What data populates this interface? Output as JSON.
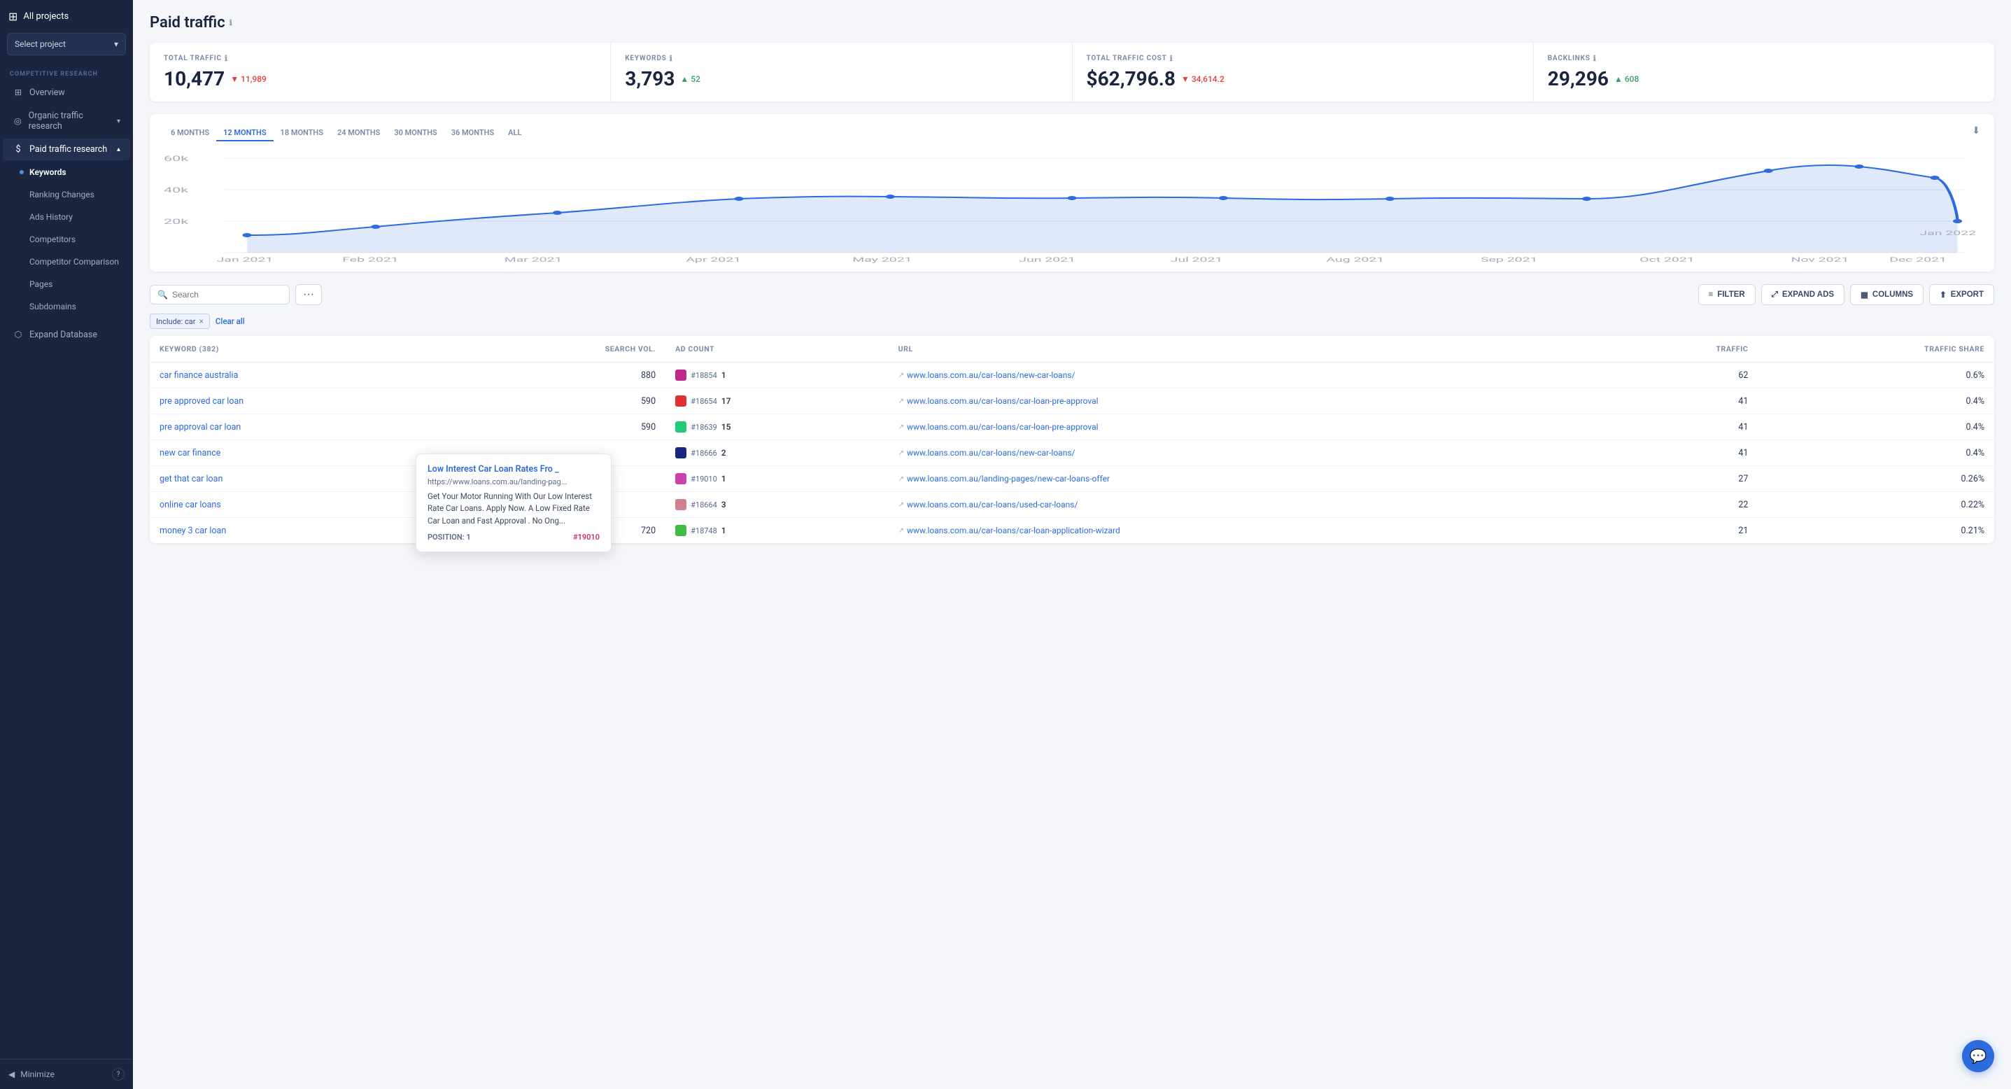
{
  "sidebar": {
    "allProjects": "All projects",
    "selectProject": "Select project",
    "sectionLabel": "COMPETITIVE RESEARCH",
    "items": [
      {
        "id": "overview",
        "label": "Overview",
        "icon": "grid",
        "type": "top"
      },
      {
        "id": "organic-traffic",
        "label": "Organic traffic research",
        "icon": "eye",
        "type": "top",
        "expandable": true
      },
      {
        "id": "paid-traffic",
        "label": "Paid traffic research",
        "icon": "dollar",
        "type": "top",
        "expandable": true,
        "active": true
      },
      {
        "id": "keywords",
        "label": "Keywords",
        "type": "sub",
        "active": true
      },
      {
        "id": "ranking-changes",
        "label": "Ranking Changes",
        "type": "sub"
      },
      {
        "id": "ads-history",
        "label": "Ads History",
        "type": "sub"
      },
      {
        "id": "competitors",
        "label": "Competitors",
        "type": "sub"
      },
      {
        "id": "competitor-comparison",
        "label": "Competitor Comparison",
        "type": "sub"
      },
      {
        "id": "pages",
        "label": "Pages",
        "type": "sub"
      },
      {
        "id": "subdomains",
        "label": "Subdomains",
        "type": "sub"
      },
      {
        "id": "expand-database",
        "label": "Expand Database",
        "icon": "database",
        "type": "top"
      }
    ],
    "minimize": "Minimize"
  },
  "pageTitle": "Paid traffic",
  "stats": [
    {
      "label": "TOTAL TRAFFIC",
      "value": "10,477",
      "delta": "▼ 11,989",
      "deltaType": "down"
    },
    {
      "label": "KEYWORDS",
      "value": "3,793",
      "delta": "▲ 52",
      "deltaType": "up"
    },
    {
      "label": "TOTAL TRAFFIC COST",
      "value": "$62,796.8",
      "delta": "▼ 34,614.2",
      "deltaType": "down"
    },
    {
      "label": "BACKLINKS",
      "value": "29,296",
      "delta": "▲ 608",
      "deltaType": "up"
    }
  ],
  "timeTabs": [
    "6 MONTHS",
    "12 MONTHS",
    "18 MONTHS",
    "24 MONTHS",
    "30 MONTHS",
    "36 MONTHS",
    "ALL"
  ],
  "activeTimeTab": "12 MONTHS",
  "chart": {
    "yLabels": [
      "60k",
      "40k",
      "20k"
    ],
    "xLabels": [
      "Jan 2021",
      "Feb 2021",
      "Mar 2021",
      "Apr 2021",
      "May 2021",
      "Jun 2021",
      "Jul 2021",
      "Aug 2021",
      "Sep 2021",
      "Oct 2021",
      "Nov 2021",
      "Dec 2021",
      "Jan 2022"
    ]
  },
  "toolbar": {
    "searchPlaceholder": "Search",
    "filterLabel": "FILTER",
    "expandAdsLabel": "EXPAND ADS",
    "columnsLabel": "COLUMNS",
    "exportLabel": "EXPORT"
  },
  "filterTags": [
    {
      "text": "Include: car",
      "removable": true
    }
  ],
  "clearAll": "Clear all",
  "table": {
    "columns": [
      {
        "id": "keyword",
        "label": "KEYWORD (382)",
        "align": "left"
      },
      {
        "id": "searchvol",
        "label": "SEARCH VOL.",
        "align": "right"
      },
      {
        "id": "adcount",
        "label": "AD COUNT",
        "align": "left"
      },
      {
        "id": "url",
        "label": "URL",
        "align": "left"
      },
      {
        "id": "traffic",
        "label": "TRAFFIC",
        "align": "right"
      },
      {
        "id": "trafficshare",
        "label": "TRAFFIC SHARE",
        "align": "right"
      }
    ],
    "rows": [
      {
        "keyword": "car finance australia",
        "searchvol": "880",
        "adColor": "#c0288a",
        "adId": "#18854",
        "adCount": "1",
        "url": "www.loans.com.au/car-loans/new-car-loans/",
        "traffic": "62",
        "trafficShare": "0.6%"
      },
      {
        "keyword": "pre approved car loan",
        "searchvol": "590",
        "adColor": "#e03030",
        "adId": "#18654",
        "adCount": "17",
        "url": "www.loans.com.au/car-loans/car-loan-pre-approval",
        "traffic": "41",
        "trafficShare": "0.4%"
      },
      {
        "keyword": "pre approval car loan",
        "searchvol": "590",
        "adColor": "#22cc77",
        "adId": "#18639",
        "adCount": "15",
        "url": "www.loans.com.au/car-loans/car-loan-pre-approval",
        "traffic": "41",
        "trafficShare": "0.4%"
      },
      {
        "keyword": "new car finance",
        "searchvol": "",
        "adColor": "#1a2580",
        "adId": "#18666",
        "adCount": "2",
        "url": "www.loans.com.au/car-loans/new-car-loans/",
        "traffic": "41",
        "trafficShare": "0.4%",
        "hasTooltip": true
      },
      {
        "keyword": "get that car loan",
        "searchvol": "",
        "adColor": "#cc44aa",
        "adId": "#19010",
        "adCount": "1",
        "url": "www.loans.com.au/landing-pages/new-car-loans-offer",
        "traffic": "27",
        "trafficShare": "0.26%"
      },
      {
        "keyword": "online car loans",
        "searchvol": "",
        "adColor": "#d08090",
        "adId": "#18664",
        "adCount": "3",
        "url": "www.loans.com.au/car-loans/used-car-loans/",
        "traffic": "22",
        "trafficShare": "0.22%"
      },
      {
        "keyword": "money 3 car loan",
        "searchvol": "720",
        "adColor": "#44bb44",
        "adId": "#18748",
        "adCount": "1",
        "url": "www.loans.com.au/car-loans/car-loan-application-wizard",
        "traffic": "21",
        "trafficShare": "0.21%"
      }
    ]
  },
  "tooltip": {
    "title": "Low Interest Car Loan Rates Fro _",
    "url": "https://www.loans.com.au/landing-pag...",
    "description": "Get Your Motor Running With Our Low Interest Rate Car Loans. Apply Now. A Low Fixed Rate Car Loan and Fast Approval . No Ong...",
    "position": "POSITION: 1",
    "adId": "#19010"
  },
  "lastUrlRow": "wwWloanscom.au/car-loans/car-loan-application-wizard"
}
